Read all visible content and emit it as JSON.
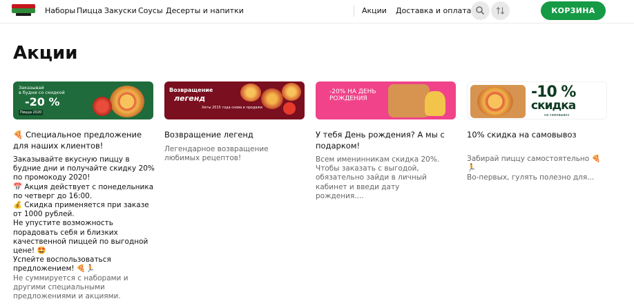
{
  "header": {
    "nav": [
      "Наборы",
      "Пицца",
      "Закуски",
      "Соусы",
      "Десерты и напитки"
    ],
    "nav_right": [
      "Акции",
      "Доставка и оплата"
    ],
    "cart_label": "КОРЗИНА",
    "icons": [
      "search-icon",
      "sort-icon"
    ]
  },
  "page_title": "Акции",
  "promos": [
    {
      "banner": {
        "line1": "Заказывай",
        "line2": "в будни со скидкой",
        "discount": "-20 %",
        "year": "Пицца 2020"
      },
      "title_emoji": "🍕",
      "title": "Специальное предложение для наших клиентов!",
      "desc_lines": [
        {
          "emoji": "",
          "text": "Заказывайте вкусную пиццу в будние дни и получайте скидку 20% по промокоду 2020!"
        },
        {
          "emoji": "📅",
          "text": "Акция действует с понедельника по четверг до 16:00."
        },
        {
          "emoji": "💰",
          "text": "Скидка применяется при заказе от 1000 рублей."
        },
        {
          "emoji": "",
          "text": "Не упустите возможность порадовать себя и близких качественной пиццей по выгодной цене! 🤩"
        },
        {
          "emoji": "",
          "text": "Успейте воспользоваться предложением! 🍕🏃"
        }
      ],
      "desc_grey": "Не суммируется с наборами и другими специальными предложениями и акциями."
    },
    {
      "banner": {
        "line1": "Возвращение",
        "line2": "легенд",
        "line3": "Хиты 2015 года снова в продаже"
      },
      "title": "Возвращение легенд",
      "desc": "Легендарное возвращение любимых рецептов!"
    },
    {
      "banner": {
        "text": "-20% НА ДЕНЬ РОЖДЕНИЯ"
      },
      "title": "У тебя День рождения? А мы с подарком!",
      "desc": "Всем именинникам скидка 20%. Чтобы заказать с выгодой, обязательно зайди в личный кабинет и введи дату рождения...."
    },
    {
      "banner": {
        "big": "-10 %",
        "big2": "скидка",
        "small": "на самовывоз"
      },
      "title": "10% скидка на самовывоз",
      "desc": "Забирай пиццу самостоятельно 🍕🏃",
      "desc2": "Во-первых, гулять полезно для..."
    }
  ],
  "colors": {
    "accent": "#169a45",
    "brand_red": "#c4161c"
  }
}
